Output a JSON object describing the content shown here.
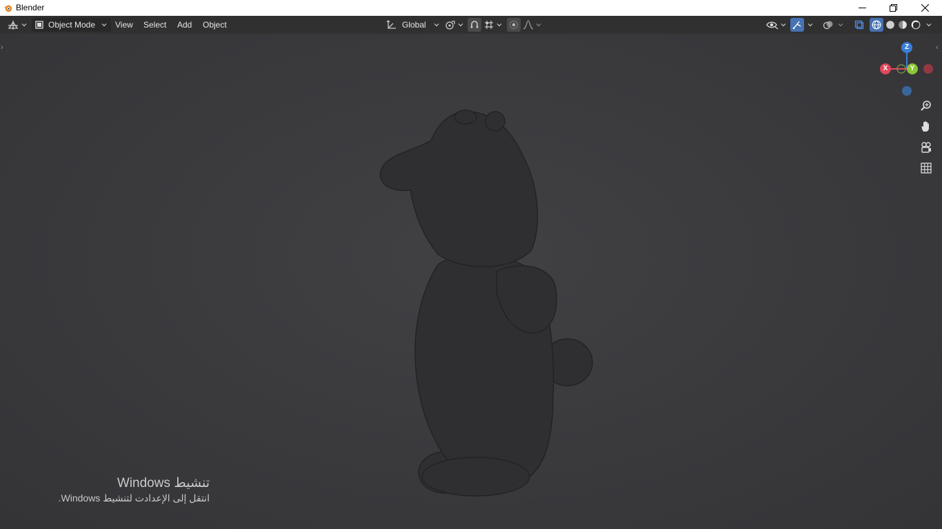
{
  "window": {
    "title": "Blender",
    "controls": [
      "minimize-icon",
      "restore-icon",
      "close-icon"
    ]
  },
  "header": {
    "editor_type_icon": "editor-type-icon",
    "mode": "Object Mode",
    "menus": [
      "View",
      "Select",
      "Add",
      "Object"
    ],
    "transform_orientation": "Global",
    "pivot_icon": "pivot-point-icon",
    "snap_icon": "snap-icon",
    "snap_target_icon": "snap-increment-icon",
    "proportional_icon": "proportional-editing-icon",
    "falloff_icon": "falloff-curve-icon",
    "right_icons": [
      "visibility-icon",
      "gizmo-icon",
      "overlay-icon",
      "xray-icon",
      "wireframe-shading-icon",
      "solid-shading-icon",
      "material-shading-icon",
      "rendered-shading-icon"
    ]
  },
  "gizmo": {
    "axes": {
      "x": "X",
      "y": "Y",
      "z": "Z"
    },
    "colors": {
      "x": "#e0475a",
      "y": "#8bc535",
      "z": "#3b7fd6"
    }
  },
  "nav_tools": [
    "zoom-icon",
    "pan-hand-icon",
    "camera-view-icon",
    "ortho-grid-icon"
  ],
  "watermark": {
    "line1": "تنشيط Windows",
    "line2": "انتقل إلى الإعدادت لتنشيط Windows."
  },
  "scene": {
    "object": "teddy-bear-wireframe-mesh"
  }
}
